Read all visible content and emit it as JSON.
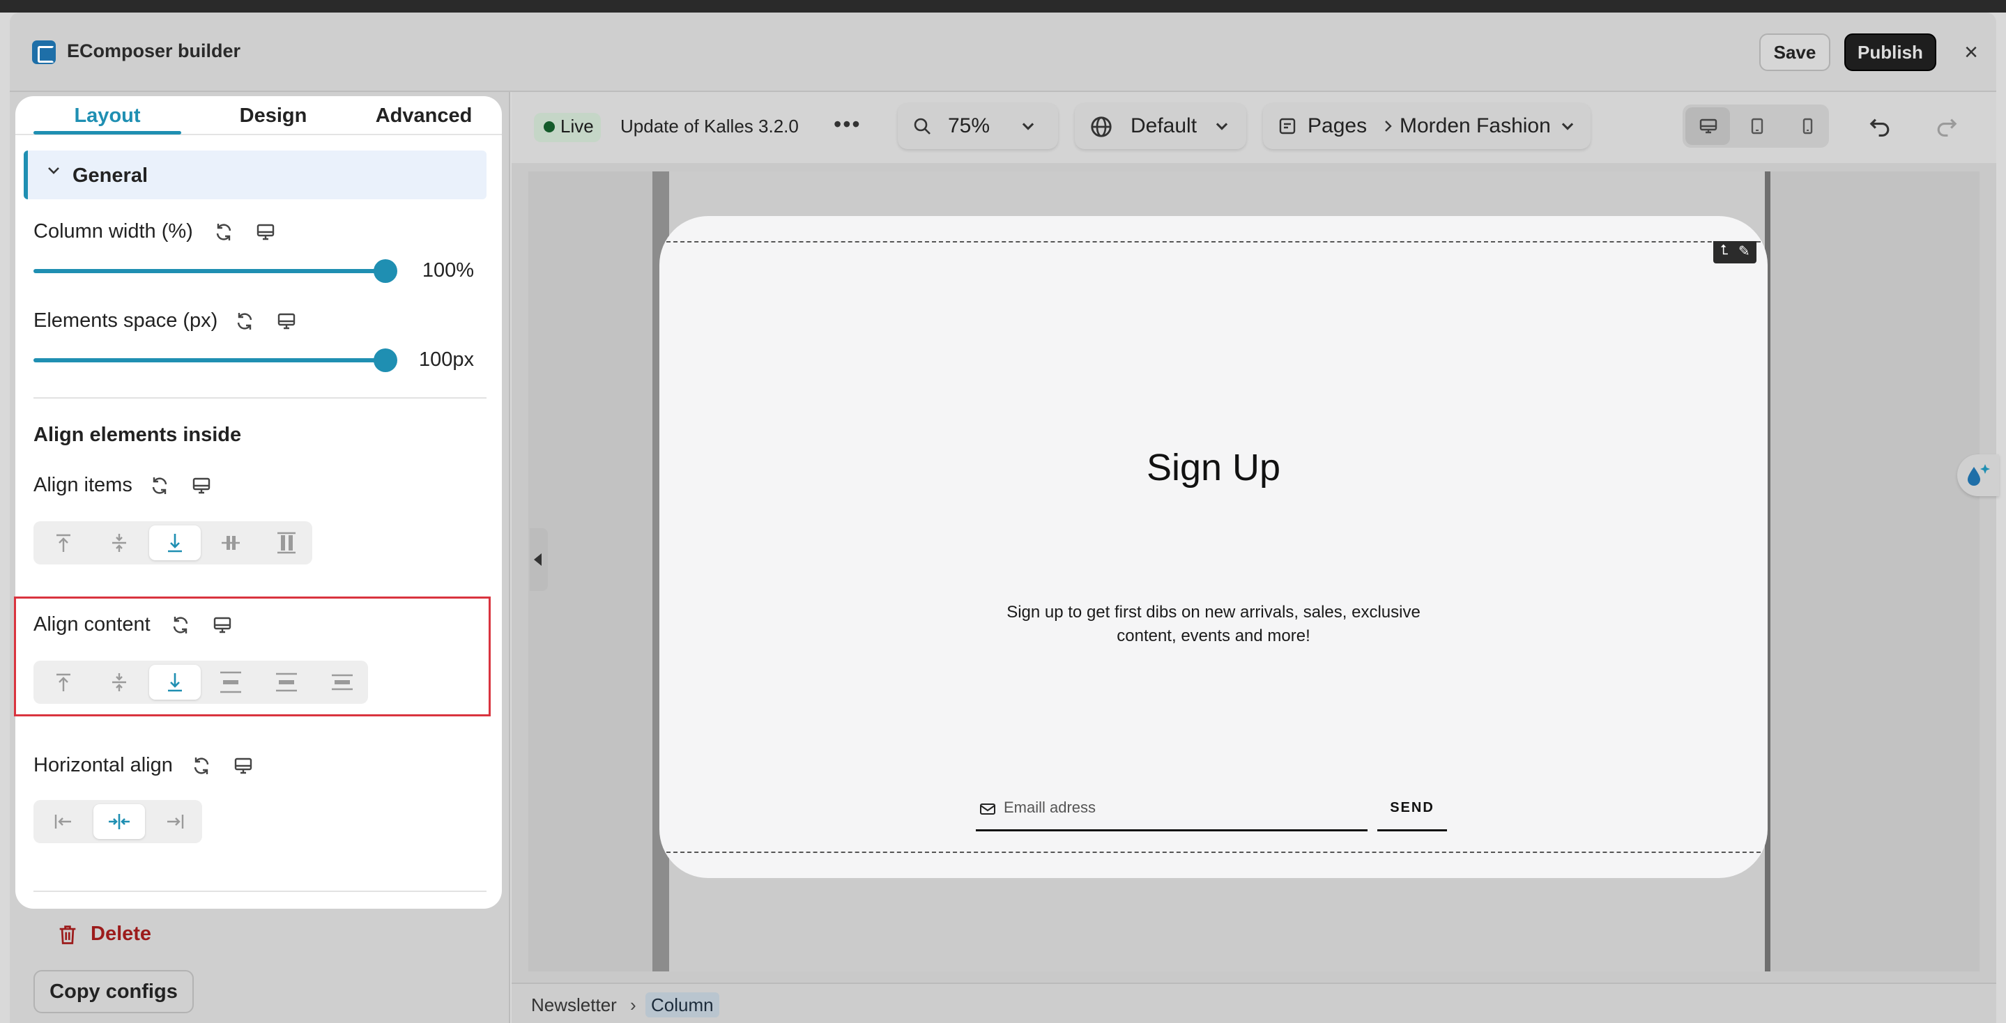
{
  "app": {
    "title": "EComposer builder"
  },
  "header": {
    "save_label": "Save",
    "publish_label": "Publish",
    "close_glyph": "×"
  },
  "tabs": [
    {
      "label": "Layout"
    },
    {
      "label": "Design"
    },
    {
      "label": "Advanced"
    }
  ],
  "section": {
    "title": "General"
  },
  "controls": {
    "column_width": {
      "label": "Column width (%)",
      "value": "100%",
      "level": 1.0
    },
    "elements_space": {
      "label": "Elements space (px)",
      "value": "100px",
      "level": 1.0
    },
    "align_heading": "Align elements inside",
    "align_items": {
      "label": "Align items",
      "options": [
        "top",
        "center",
        "bottom",
        "stretch",
        "baseline"
      ],
      "selected": "bottom"
    },
    "align_content": {
      "label": "Align content",
      "options": [
        "top",
        "center",
        "bottom",
        "space-between",
        "space-around",
        "space-evenly"
      ],
      "selected": "bottom"
    },
    "horizontal_align": {
      "label": "Horizontal align",
      "options": [
        "left",
        "center",
        "right"
      ],
      "selected": "center"
    }
  },
  "footer_actions": {
    "delete_label": "Delete",
    "copy_label": "Copy configs"
  },
  "toolbar": {
    "status": "Live",
    "theme_name": "Update of Kalles 3.2.0",
    "more_glyph": "•••",
    "zoom": "75%",
    "locale": "Default",
    "pages_label": "Pages",
    "page_name": "Morden Fashion"
  },
  "preview": {
    "heading": "Sign Up",
    "subtext": "Sign up to get first dibs on new arrivals, sales, exclusive content, events and more!",
    "email_placeholder": "Emaill adress",
    "send_label": "SEND"
  },
  "breadcrumb": [
    {
      "label": "Newsletter"
    },
    {
      "label": "Column"
    }
  ],
  "breadcrumb_sep": "›",
  "colors": {
    "accent": "#1f8fb2",
    "publish": "#1e1e1e",
    "delete": "#9c1b1b",
    "highlight": "#d9343f"
  },
  "icons": [
    "reset-icon",
    "desktop-icon",
    "search-icon",
    "globe-icon",
    "pages-icon",
    "undo-icon",
    "redo-icon",
    "mail-icon",
    "trash-icon",
    "tablet-icon",
    "mobile-icon",
    "magic-drop-icon"
  ]
}
